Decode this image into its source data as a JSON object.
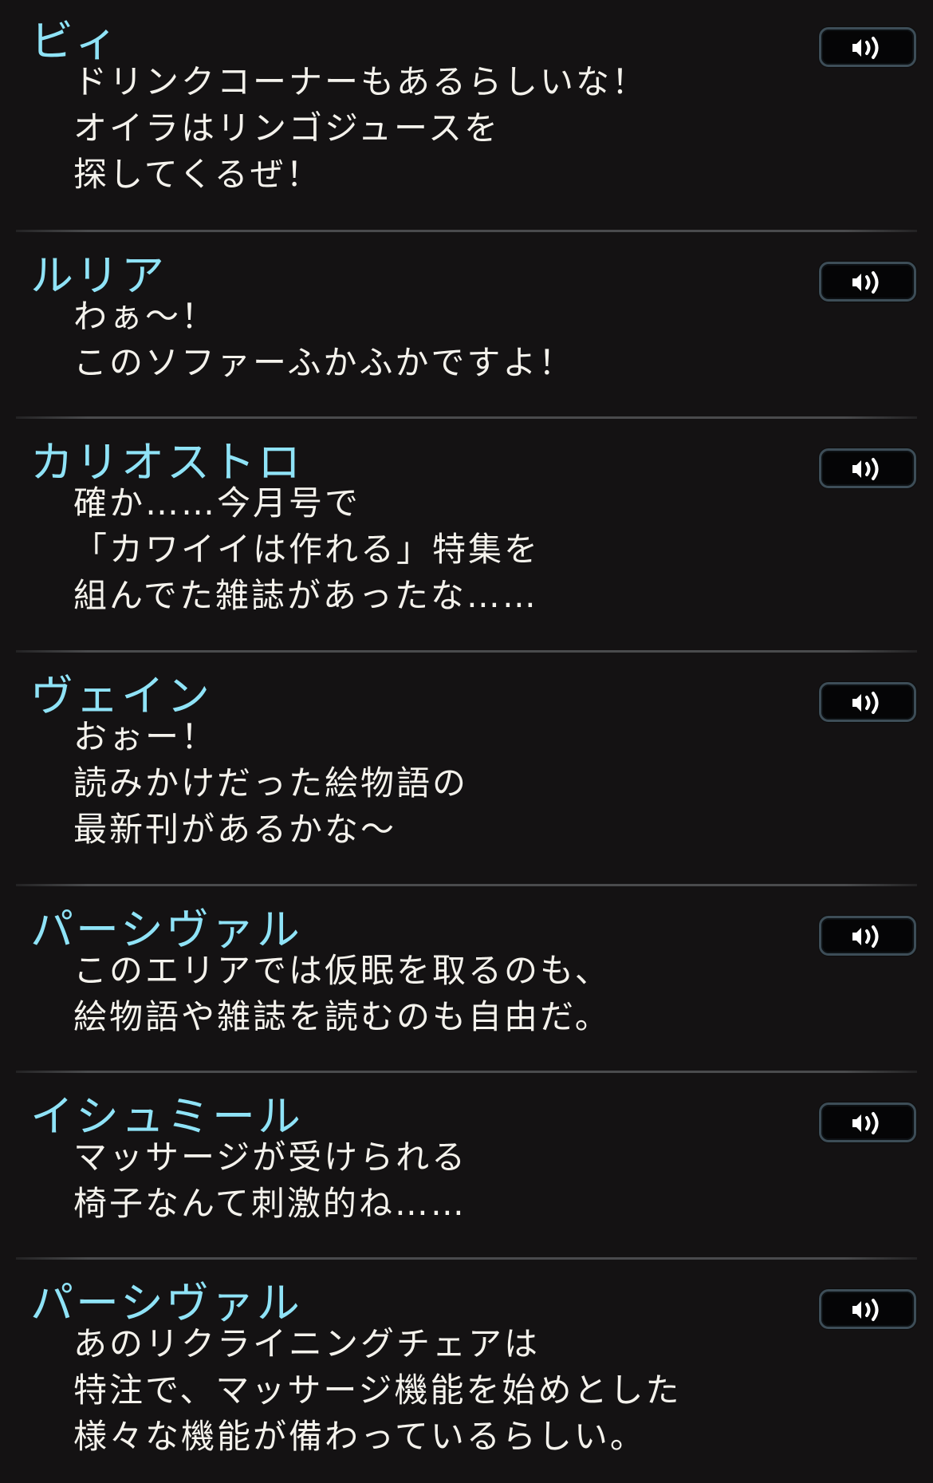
{
  "entries": [
    {
      "speaker": "ビィ",
      "lines": [
        "ドリンクコーナーもあるらしいな！",
        "オイラはリンゴジュースを",
        "探してくるぜ！"
      ]
    },
    {
      "speaker": "ルリア",
      "lines": [
        "わぁ～！",
        "このソファーふかふかですよ！"
      ]
    },
    {
      "speaker": "カリオストロ",
      "lines": [
        "確か……今月号で",
        "「カワイイは作れる」特集を",
        "組んでた雑誌があったな……"
      ]
    },
    {
      "speaker": "ヴェイン",
      "lines": [
        "おぉー！",
        "読みかけだった絵物語の",
        "最新刊があるかな～"
      ]
    },
    {
      "speaker": "パーシヴァル",
      "lines": [
        "このエリアでは仮眠を取るのも、",
        "絵物語や雑誌を読むのも自由だ。"
      ]
    },
    {
      "speaker": "イシュミール",
      "lines": [
        "マッサージが受けられる",
        "椅子なんて刺激的ね……"
      ]
    },
    {
      "speaker": "パーシヴァル",
      "lines": [
        "あのリクライニングチェアは",
        "特注で、マッサージ機能を始めとした",
        "様々な機能が備わっているらしい。"
      ]
    }
  ],
  "icons": {
    "voice_button": "speaker-icon"
  },
  "colors": {
    "background": "#141213",
    "speaker_name": "#8fe3f7",
    "dialogue_text": "#f4f2ec",
    "button_border": "#3d4d57",
    "divider": "#4a4b4d"
  }
}
